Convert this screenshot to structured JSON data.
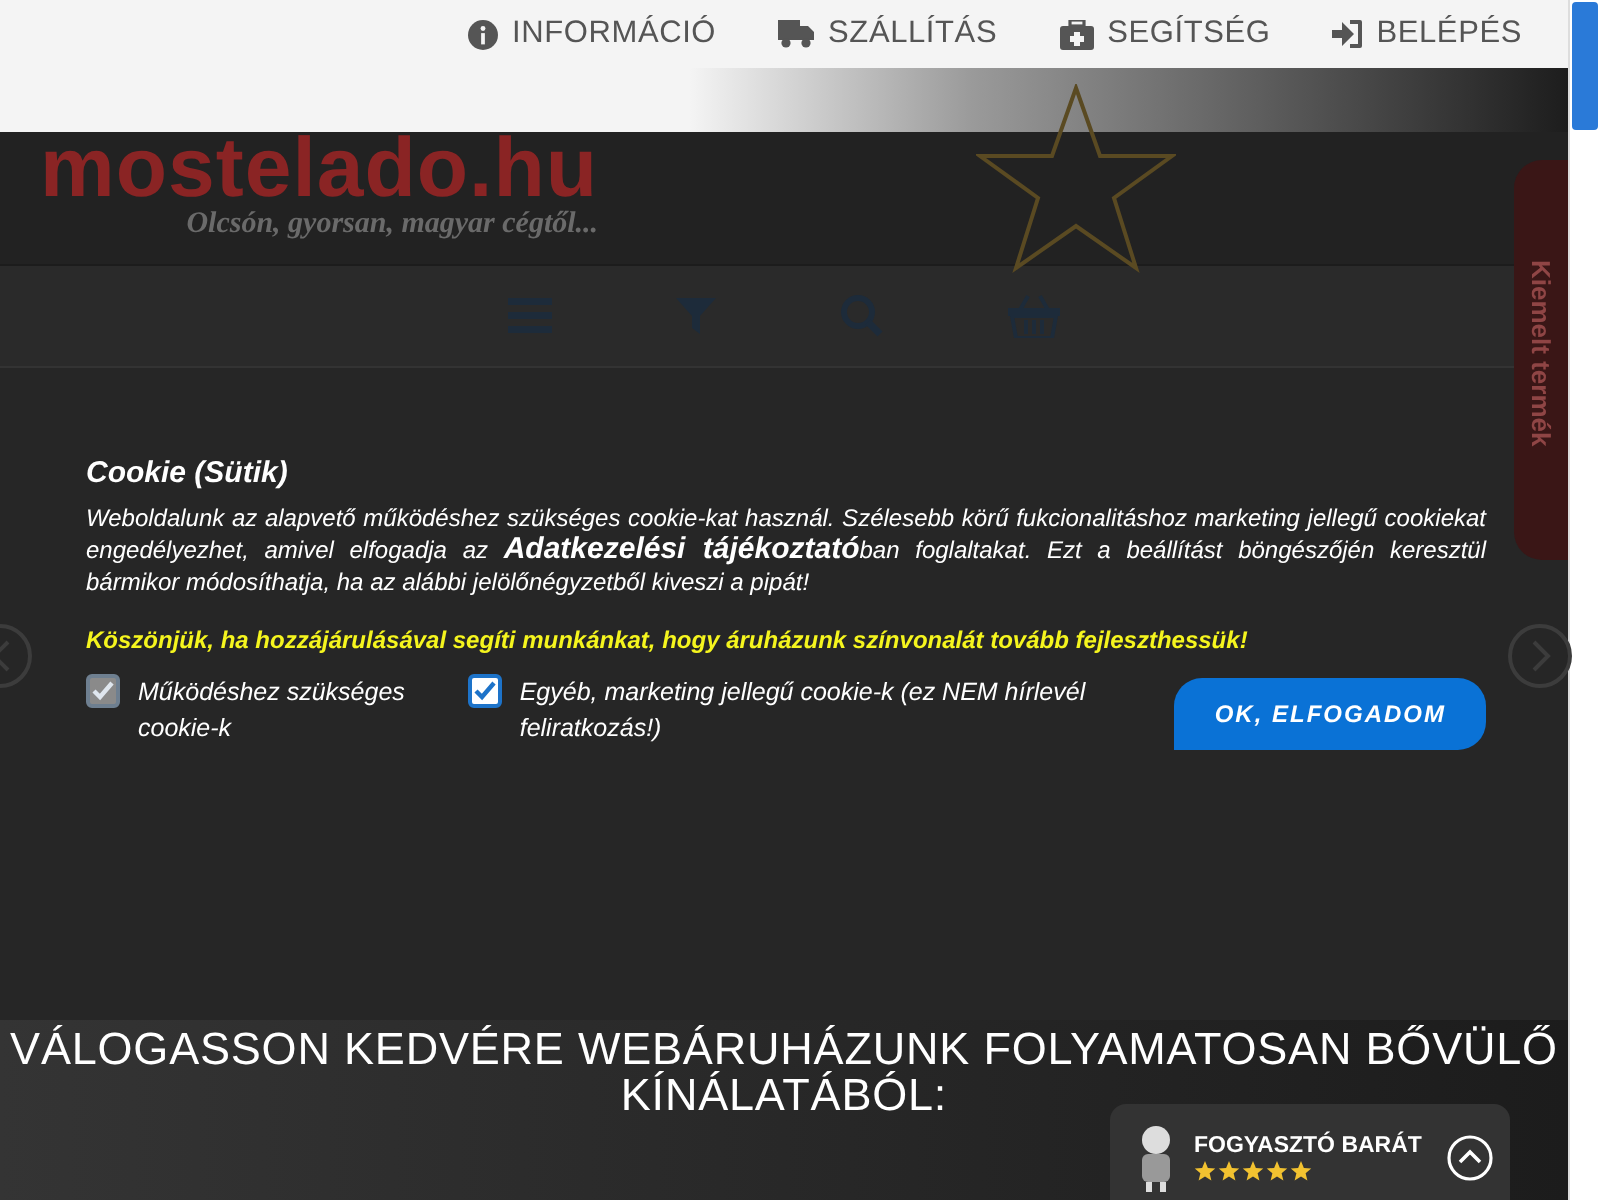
{
  "top_nav": [
    {
      "kind": "info",
      "label": "INFORMÁCIÓ"
    },
    {
      "kind": "shipping",
      "label": "SZÁLLÍTÁS"
    },
    {
      "kind": "help",
      "label": "SEGÍTSÉG"
    },
    {
      "kind": "login",
      "label": "BELÉPÉS"
    }
  ],
  "logo": {
    "name": "mostelado.hu",
    "tagline": "Olcsón, gyorsan, magyar cégtől..."
  },
  "side_tab": {
    "label": "Kiemelt termék"
  },
  "cookie": {
    "title": "Cookie (Sütik)",
    "body": "Weboldalunk az alapvető működéshez szükséges cookie-kat használ. Szélesebb körű fukcionalitáshoz marketing jellegű cookiekat engedélyezhet, amivel elfogadja az **Adatkezelési tájékoztató**ban foglaltakat. Ezt a beállítást böngészőjén keresztül bármikor módosíthatja, ha az alábbi jelölőnégyzetből kiveszi a pipát!",
    "thanks": "Köszönjük, ha hozzájárulásával segíti munkánkat, hogy áruházunk színvonalát tovább fejleszthessük!",
    "options": [
      {
        "label": "Működéshez szükséges cookie-k",
        "checked": true,
        "disabled": true
      },
      {
        "label": "Egyéb, marketing jellegű cookie-k (ez NEM hírlevél feliratkozás!)",
        "checked": true,
        "disabled": false
      }
    ],
    "accept_button": "OK, ELFOGADOM"
  },
  "heading": "VÁLOGASSON KEDVÉRE WEBÁRUHÁZUNK FOLYAMATOSAN BŐVÜLŐ KÍNÁLATÁBÓL:",
  "badge": {
    "label": "FOGYASZTÓ BARÁT",
    "stars": 5
  }
}
